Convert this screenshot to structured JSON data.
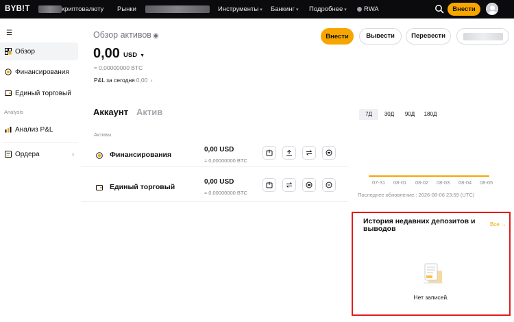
{
  "header": {
    "logo": "BYB!T",
    "nav": [
      {
        "label": "криптовалюту",
        "chevron": false
      },
      {
        "label": "Рынки",
        "chevron": false
      },
      {
        "label": "Инструменты",
        "chevron": true
      },
      {
        "label": "Банкинг",
        "chevron": true
      },
      {
        "label": "Подробнее",
        "chevron": true
      },
      {
        "label": "RWA",
        "chevron": false
      }
    ],
    "deposit_label": "Внести"
  },
  "sidebar": {
    "items": [
      {
        "label": "Обзор",
        "icon": "overview-icon",
        "active": true
      },
      {
        "label": "Финансирования",
        "icon": "funding-icon",
        "active": false
      },
      {
        "label": "Единый торговый",
        "icon": "wallet-icon",
        "active": false
      },
      {
        "label": "Анализ P&L",
        "icon": "bar-chart-icon",
        "active": false
      },
      {
        "label": "Ордера",
        "icon": "orders-icon",
        "active": false
      }
    ],
    "section_label": "Analysis"
  },
  "overview": {
    "title": "Обзор активов",
    "balance": "0,00",
    "currency": "USD",
    "balance_btc": "≈ 0,00000000 BTC",
    "pnl_label": "P&L за сегодня",
    "pnl_value": "0,00"
  },
  "actions": {
    "deposit": "Внести",
    "withdraw": "Вывести",
    "transfer": "Перевести"
  },
  "tabs": [
    {
      "label": "Аккаунт",
      "active": true
    },
    {
      "label": "Актив",
      "active": false
    }
  ],
  "assets": {
    "label": "Активы",
    "rows": [
      {
        "name": "Финансирования",
        "usd": "0,00 USD",
        "btc": "≈ 0,00000000 BTC"
      },
      {
        "name": "Единый торговый",
        "usd": "0,00 USD",
        "btc": "≈ 0,00000000 BTC"
      }
    ]
  },
  "chart": {
    "ranges": [
      "7Д",
      "30Д",
      "90Д",
      "180Д"
    ],
    "selected_range": "7Д",
    "x_ticks": [
      "07-31",
      "08-01",
      "08-02",
      "08-03",
      "08-04",
      "08-05"
    ],
    "updated": "Последнее обновление:: 2026-08-06 23:59 (UTC)"
  },
  "history": {
    "title": "История недавних депозитов и выводов",
    "all_label": "Все",
    "empty_text": "Нет записей."
  },
  "colors": {
    "accent": "#f7a600",
    "highlight_border": "#e21b1b",
    "topbar": "#0b0b0d"
  }
}
